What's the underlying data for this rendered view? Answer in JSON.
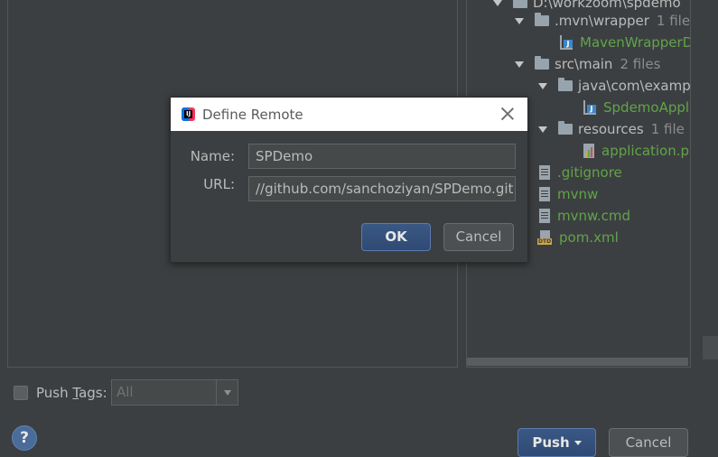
{
  "tree": {
    "root_label": "D:\\workzoom\\spdemo",
    "rows": [
      {
        "label": ".mvn\\wrapper",
        "count": "1 file"
      },
      {
        "label": "MavenWrapperD"
      },
      {
        "label": "src\\main",
        "count": "2 files"
      },
      {
        "label": "java\\com\\examp"
      },
      {
        "label": "SpdemoAppl"
      },
      {
        "label": "resources",
        "count": "1 file"
      },
      {
        "label": "application.p"
      },
      {
        "label": ".gitignore"
      },
      {
        "label": "mvnw"
      },
      {
        "label": "mvnw.cmd"
      },
      {
        "label": "pom.xml"
      }
    ]
  },
  "bottom": {
    "push_tags_label": "Push ",
    "push_tags_underlined": "T",
    "push_tags_rest": "ags:",
    "tags_value": "All",
    "help_label": "?",
    "push_label": "Push",
    "cancel_label": "Cancel"
  },
  "dialog": {
    "title": "Define Remote",
    "name_label": "Name:",
    "name_value": "SPDemo",
    "url_label": "URL:",
    "url_value": "//github.com/sanchoziyan/SPDemo.git",
    "ok_label": "OK",
    "cancel_label": "Cancel"
  },
  "colors": {
    "background": "#3c3f41",
    "file_green": "#62a34a",
    "primary_button": "#365880",
    "dialog_title_bg": "#ffffff"
  }
}
